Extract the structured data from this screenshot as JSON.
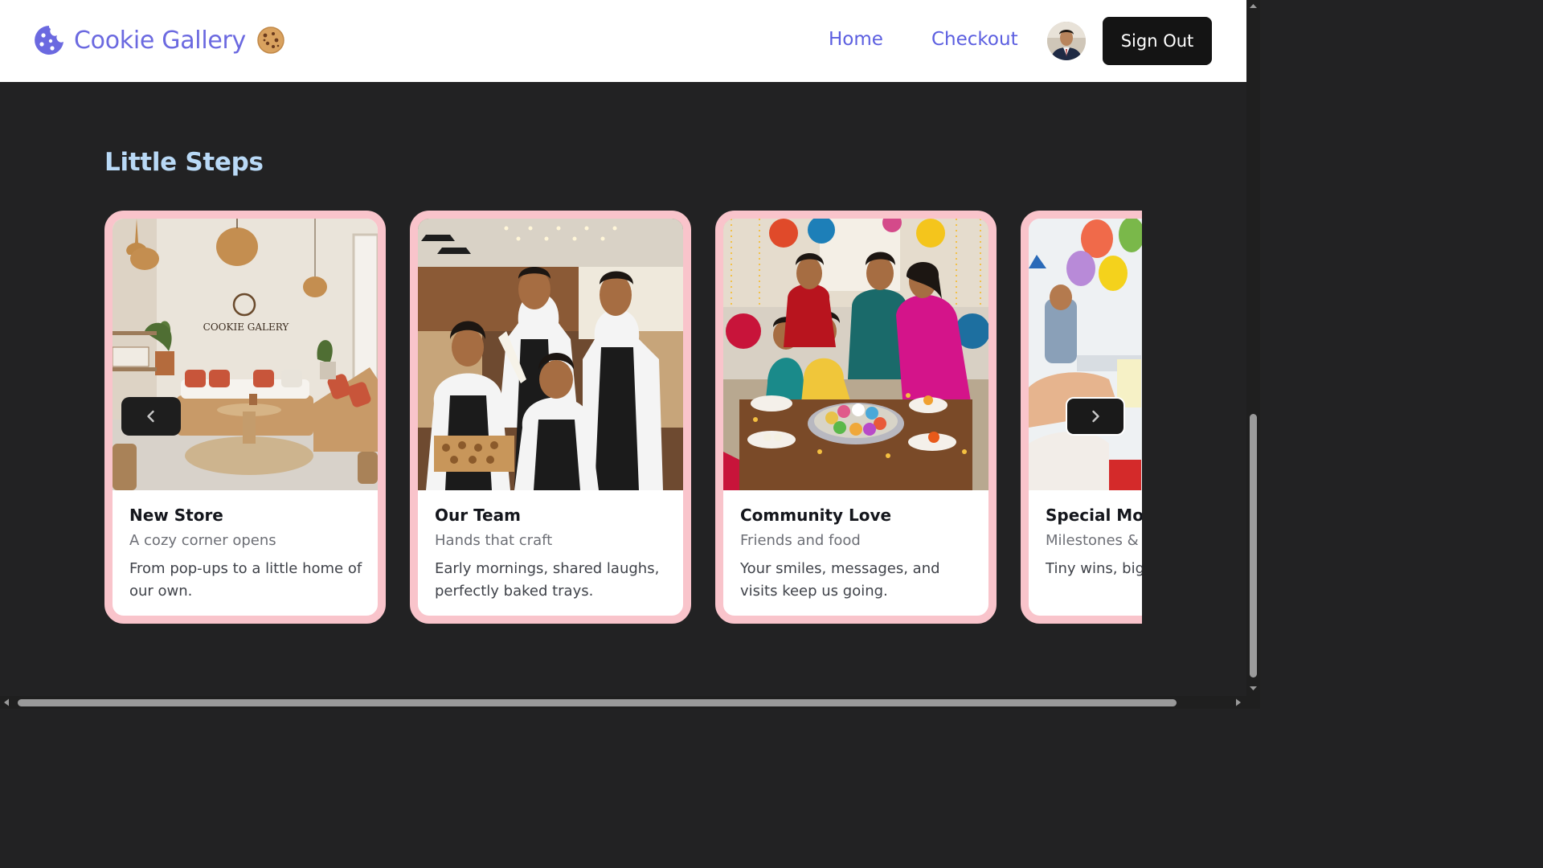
{
  "nav": {
    "brand_name": "Cookie Gallery",
    "links": [
      "Home",
      "Checkout"
    ],
    "sign_out_label": "Sign Out"
  },
  "section": {
    "title": "Little Steps"
  },
  "cards": [
    {
      "title": "New Store",
      "subtitle": "A cozy corner opens",
      "text": "From pop-ups to a little home of our own."
    },
    {
      "title": "Our Team",
      "subtitle": "Hands that craft",
      "text": "Early mornings, shared laughs, perfectly baked trays."
    },
    {
      "title": "Community Love",
      "subtitle": "Friends and food",
      "text": "Your smiles, messages, and visits keep us going."
    },
    {
      "title": "Special Mom",
      "subtitle": "Milestones &",
      "text": "Tiny wins, big to many more"
    }
  ],
  "colors": {
    "background": "#222223",
    "brand": "#6b69e0",
    "nav_link": "#5b5ee0",
    "card_border": "#f9c4cb",
    "section_title": "#b9d9f6"
  },
  "icons": {
    "brand": "cookie-bite-icon",
    "brand_emoji": "cookie-icon",
    "prev": "chevron-left-icon",
    "next": "chevron-right-icon"
  }
}
